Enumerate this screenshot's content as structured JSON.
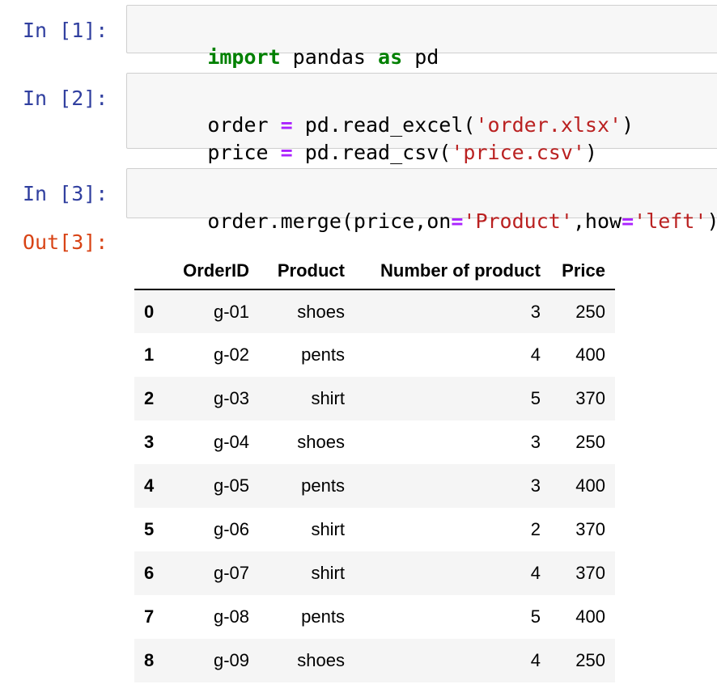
{
  "cells": [
    {
      "prompt": "In [1]:",
      "lines": [
        [
          {
            "t": "import",
            "c": "kw"
          },
          {
            "t": " pandas ",
            "c": ""
          },
          {
            "t": "as",
            "c": "kw"
          },
          {
            "t": " pd",
            "c": ""
          }
        ]
      ]
    },
    {
      "prompt": "In [2]:",
      "lines": [
        [
          {
            "t": "order ",
            "c": ""
          },
          {
            "t": "=",
            "c": "op"
          },
          {
            "t": " pd.read_excel(",
            "c": ""
          },
          {
            "t": "'order.xlsx'",
            "c": "str"
          },
          {
            "t": ")",
            "c": ""
          }
        ],
        [
          {
            "t": "price ",
            "c": ""
          },
          {
            "t": "=",
            "c": "op"
          },
          {
            "t": " pd.read_csv(",
            "c": ""
          },
          {
            "t": "'price.csv'",
            "c": "str"
          },
          {
            "t": ")",
            "c": ""
          }
        ]
      ]
    },
    {
      "prompt": "In [3]:",
      "lines": [
        [
          {
            "t": "order.merge(price,on",
            "c": ""
          },
          {
            "t": "=",
            "c": "op"
          },
          {
            "t": "'Product'",
            "c": "str"
          },
          {
            "t": ",how",
            "c": ""
          },
          {
            "t": "=",
            "c": "op"
          },
          {
            "t": "'left'",
            "c": "str"
          },
          {
            "t": ")",
            "c": ""
          }
        ]
      ]
    }
  ],
  "output": {
    "prompt": "Out[3]:",
    "columns": [
      "",
      "OrderID",
      "Product",
      "Number of product",
      "Price"
    ],
    "rows": [
      [
        "0",
        "g-01",
        "shoes",
        "3",
        "250"
      ],
      [
        "1",
        "g-02",
        "pents",
        "4",
        "400"
      ],
      [
        "2",
        "g-03",
        "shirt",
        "5",
        "370"
      ],
      [
        "3",
        "g-04",
        "shoes",
        "3",
        "250"
      ],
      [
        "4",
        "g-05",
        "pents",
        "3",
        "400"
      ],
      [
        "5",
        "g-06",
        "shirt",
        "2",
        "370"
      ],
      [
        "6",
        "g-07",
        "shirt",
        "4",
        "370"
      ],
      [
        "7",
        "g-08",
        "pents",
        "5",
        "400"
      ],
      [
        "8",
        "g-09",
        "shoes",
        "4",
        "250"
      ]
    ]
  },
  "colors": {
    "in_prompt": "#303F9F",
    "out_prompt": "#D84315",
    "keyword": "#008000",
    "operator": "#AA22FF",
    "string": "#BA2121",
    "input_bg": "#f7f7f7",
    "input_border": "#cfcfcf",
    "row_stripe": "#f5f5f5"
  }
}
